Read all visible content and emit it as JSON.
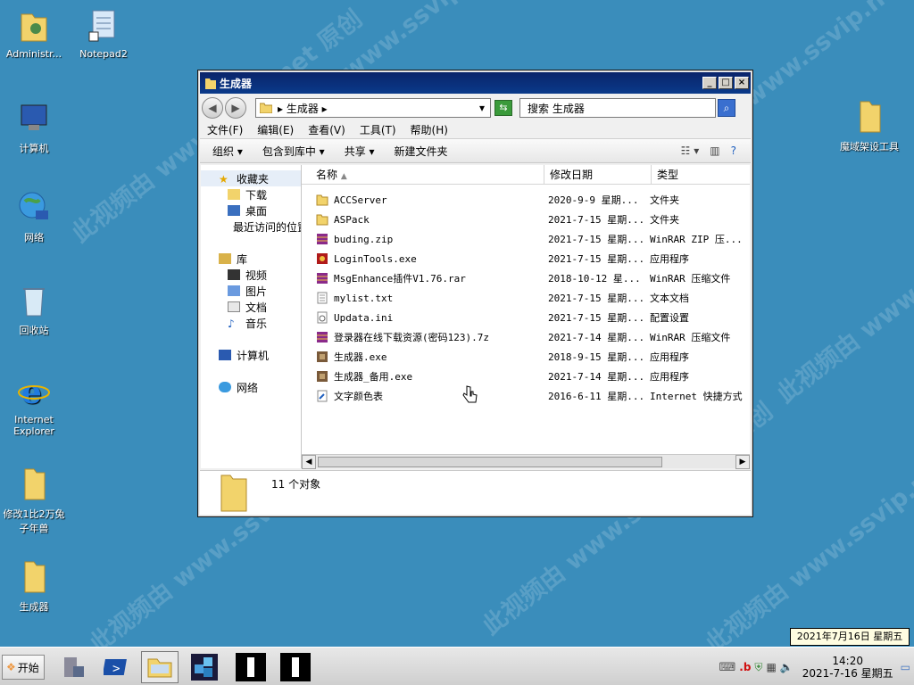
{
  "watermark": "此视频由 www.ssvip.net 原创",
  "desktop": {
    "icons": [
      {
        "label": "Administr..."
      },
      {
        "label": "Notepad2"
      },
      {
        "label": "计算机"
      },
      {
        "label": "网络"
      },
      {
        "label": "回收站"
      },
      {
        "label": "Internet Explorer"
      },
      {
        "label": "修改1比2万兔子年兽"
      },
      {
        "label": "生成器"
      },
      {
        "label": "魔域架设工具"
      }
    ]
  },
  "window": {
    "title": "生成器",
    "address": "▸ 生成器 ▸",
    "search_placeholder": "搜索 生成器",
    "menu": [
      "文件(F)",
      "编辑(E)",
      "查看(V)",
      "工具(T)",
      "帮助(H)"
    ],
    "commands": [
      "组织 ▾",
      "包含到库中 ▾",
      "共享 ▾",
      "新建文件夹"
    ],
    "nav": {
      "favorites": "收藏夹",
      "favorites_items": [
        "下载",
        "桌面",
        "最近访问的位置"
      ],
      "libraries": "库",
      "library_items": [
        "视频",
        "图片",
        "文档",
        "音乐"
      ],
      "computer": "计算机",
      "network": "网络"
    },
    "columns": {
      "name": "名称",
      "date": "修改日期",
      "type": "类型"
    },
    "files": [
      {
        "name": "ACCServer",
        "date": "2020-9-9 星期...",
        "type": "文件夹",
        "icon": "folder"
      },
      {
        "name": "ASPack",
        "date": "2021-7-15 星期...",
        "type": "文件夹",
        "icon": "folder"
      },
      {
        "name": "buding.zip",
        "date": "2021-7-15 星期...",
        "type": "WinRAR ZIP 压...",
        "icon": "rar"
      },
      {
        "name": "LoginTools.exe",
        "date": "2021-7-15 星期...",
        "type": "应用程序",
        "icon": "exe-red"
      },
      {
        "name": "MsgEnhance插件V1.76.rar",
        "date": "2018-10-12 星...",
        "type": "WinRAR 压缩文件",
        "icon": "rar"
      },
      {
        "name": "mylist.txt",
        "date": "2021-7-15 星期...",
        "type": "文本文档",
        "icon": "txt"
      },
      {
        "name": "Updata.ini",
        "date": "2021-7-15 星期...",
        "type": "配置设置",
        "icon": "ini"
      },
      {
        "name": "登录器在线下载资源(密码123).7z",
        "date": "2021-7-14 星期...",
        "type": "WinRAR 压缩文件",
        "icon": "rar"
      },
      {
        "name": "生成器.exe",
        "date": "2018-9-15 星期...",
        "type": "应用程序",
        "icon": "exe"
      },
      {
        "name": "生成器_备用.exe",
        "date": "2021-7-14 星期...",
        "type": "应用程序",
        "icon": "exe"
      },
      {
        "name": "文字颜色表",
        "date": "2016-6-11 星期...",
        "type": "Internet 快捷方式",
        "icon": "link"
      }
    ],
    "status": "11 个对象"
  },
  "taskbar": {
    "start": "开始",
    "time": "14:20",
    "date": "2021-7-16 星期五",
    "date_tooltip": "2021年7月16日 星期五"
  },
  "colors": {
    "desktop": "#3a8dbb",
    "titlebar": "#0a246a",
    "folder": "#f2d36b"
  }
}
